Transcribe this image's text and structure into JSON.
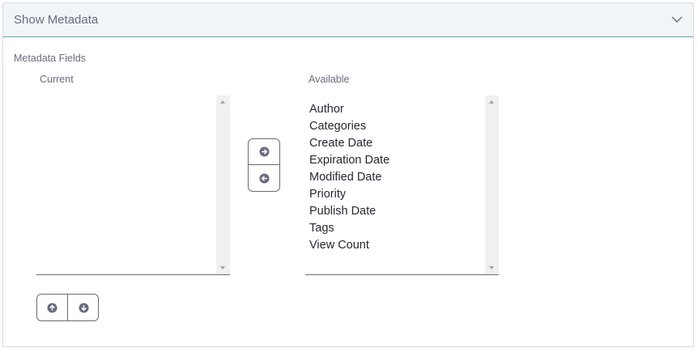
{
  "panel": {
    "title": "Show Metadata",
    "toggle_icon": "chevron-down-icon"
  },
  "metadata": {
    "section_label": "Metadata Fields",
    "current": {
      "label": "Current",
      "items": []
    },
    "available": {
      "label": "Available",
      "items": [
        "Author",
        "Categories",
        "Create Date",
        "Expiration Date",
        "Modified Date",
        "Priority",
        "Publish Date",
        "Tags",
        "View Count"
      ]
    },
    "transfer_buttons": {
      "move_right_icon": "circle-arrow-right-icon",
      "move_left_icon": "circle-arrow-left-icon"
    },
    "order_buttons": {
      "move_up_icon": "circle-arrow-up-icon",
      "move_down_icon": "circle-arrow-down-icon"
    }
  },
  "colors": {
    "header_bg": "#f1f5f8",
    "header_border": "#5aa6b8",
    "label": "#6b6c7e",
    "text": "#272833",
    "icon": "#6b6c7e"
  }
}
